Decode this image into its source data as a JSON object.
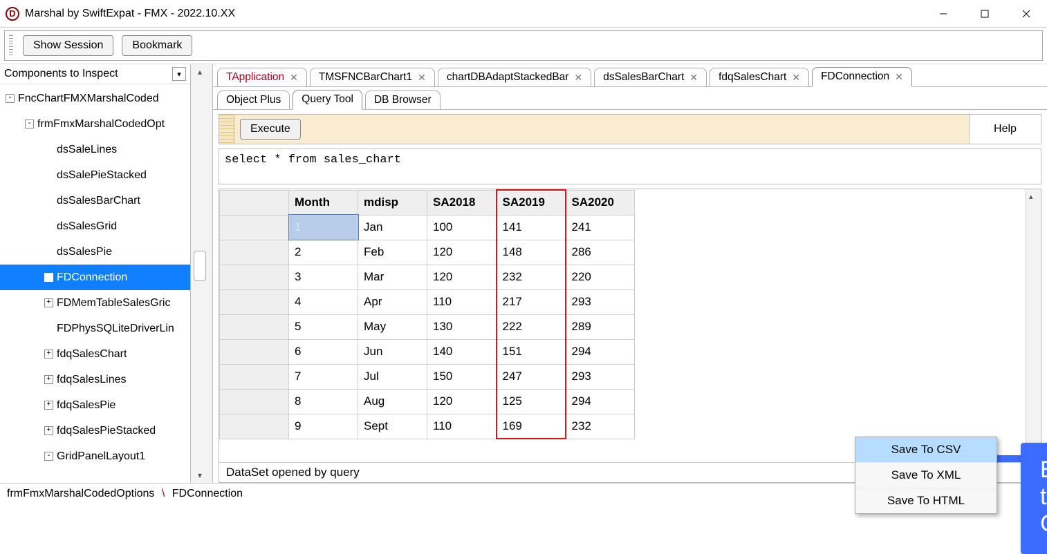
{
  "window": {
    "title": "Marshal by SwiftExpat - FMX - 2022.10.XX",
    "app_icon_letter": "D"
  },
  "toolbar": {
    "show_session": "Show Session",
    "bookmark": "Bookmark"
  },
  "sidebar": {
    "header": "Components to Inspect",
    "tree": [
      {
        "level": 0,
        "expander": "-",
        "label": "FncChartFMXMarshalCoded",
        "selected": false
      },
      {
        "level": 1,
        "expander": "-",
        "label": "frmFmxMarshalCodedOpt",
        "selected": false
      },
      {
        "level": 2,
        "expander": "",
        "label": "dsSaleLines",
        "selected": false
      },
      {
        "level": 2,
        "expander": "",
        "label": "dsSalePieStacked",
        "selected": false
      },
      {
        "level": 2,
        "expander": "",
        "label": "dsSalesBarChart",
        "selected": false
      },
      {
        "level": 2,
        "expander": "",
        "label": "dsSalesGrid",
        "selected": false
      },
      {
        "level": 2,
        "expander": "",
        "label": "dsSalesPie",
        "selected": false
      },
      {
        "level": 2,
        "expander": "",
        "label": "FDConnection",
        "selected": true
      },
      {
        "level": 2,
        "expander": "+",
        "label": "FDMemTableSalesGric",
        "selected": false
      },
      {
        "level": 2,
        "expander": "",
        "label": "FDPhysSQLiteDriverLin",
        "selected": false
      },
      {
        "level": 2,
        "expander": "+",
        "label": "fdqSalesChart",
        "selected": false
      },
      {
        "level": 2,
        "expander": "+",
        "label": "fdqSalesLines",
        "selected": false
      },
      {
        "level": 2,
        "expander": "+",
        "label": "fdqSalesPie",
        "selected": false
      },
      {
        "level": 2,
        "expander": "+",
        "label": "fdqSalesPieStacked",
        "selected": false
      },
      {
        "level": 2,
        "expander": "-",
        "label": "GridPanelLayout1",
        "selected": false
      }
    ]
  },
  "tabs_top": [
    {
      "label": "TApplication",
      "red": true,
      "closable": true,
      "active": false
    },
    {
      "label": "TMSFNCBarChart1",
      "red": false,
      "closable": true,
      "active": false
    },
    {
      "label": "chartDBAdaptStackedBar",
      "red": false,
      "closable": true,
      "active": false
    },
    {
      "label": "dsSalesBarChart",
      "red": false,
      "closable": true,
      "active": false
    },
    {
      "label": "fdqSalesChart",
      "red": false,
      "closable": true,
      "active": false
    },
    {
      "label": "FDConnection",
      "red": false,
      "closable": true,
      "active": true
    }
  ],
  "tabs_sub": [
    {
      "label": "Object Plus",
      "active": false
    },
    {
      "label": "Query Tool",
      "active": true
    },
    {
      "label": "DB Browser",
      "active": false
    }
  ],
  "query": {
    "execute": "Execute",
    "help": "Help",
    "sql": "select * from sales_chart"
  },
  "grid": {
    "headers": [
      "Month",
      "mdisp",
      "SA2018",
      "SA2019",
      "SA2020"
    ],
    "highlight_col_index": 3,
    "rows": [
      {
        "month": "1",
        "mdisp": "Jan",
        "c1": "100",
        "c2": "141",
        "c3": "241",
        "selected": true
      },
      {
        "month": "2",
        "mdisp": "Feb",
        "c1": "120",
        "c2": "148",
        "c3": "286"
      },
      {
        "month": "3",
        "mdisp": "Mar",
        "c1": "120",
        "c2": "232",
        "c3": "220"
      },
      {
        "month": "4",
        "mdisp": "Apr",
        "c1": "110",
        "c2": "217",
        "c3": "293"
      },
      {
        "month": "5",
        "mdisp": "May",
        "c1": "130",
        "c2": "222",
        "c3": "289"
      },
      {
        "month": "6",
        "mdisp": "Jun",
        "c1": "140",
        "c2": "151",
        "c3": "294"
      },
      {
        "month": "7",
        "mdisp": "Jul",
        "c1": "150",
        "c2": "247",
        "c3": "293"
      },
      {
        "month": "8",
        "mdisp": "Aug",
        "c1": "120",
        "c2": "125",
        "c3": "294"
      },
      {
        "month": "9",
        "mdisp": "Sept",
        "c1": "110",
        "c2": "169",
        "c3": "232"
      }
    ],
    "status": "DataSet opened by query"
  },
  "context_menu": {
    "items": [
      {
        "label": "Save To CSV",
        "hover": true
      },
      {
        "label": "Save To XML",
        "hover": false
      },
      {
        "label": "Save To HTML",
        "hover": false
      }
    ]
  },
  "callout": {
    "text": "Export to CSV"
  },
  "breadcrumb": {
    "a": "frmFmxMarshalCodedOptions",
    "b": "FDConnection",
    "sep": "\\"
  }
}
